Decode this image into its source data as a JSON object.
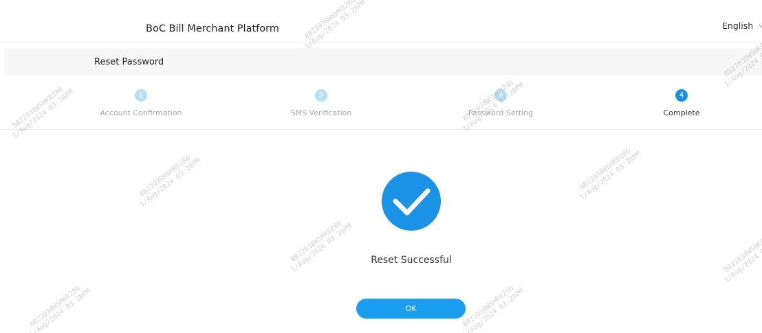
{
  "header": {
    "platform_name": "BoC Bill Merchant Platform",
    "language": "English"
  },
  "title_bar": {
    "title": "Reset Password"
  },
  "steps": [
    {
      "number": "1",
      "label": "Account Confirmation",
      "active": false
    },
    {
      "number": "2",
      "label": "SMS Verification",
      "active": false
    },
    {
      "number": "3",
      "label": "Password Setting",
      "active": false
    },
    {
      "number": "4",
      "label": "Complete",
      "active": true
    }
  ],
  "result": {
    "message": "Reset Successful",
    "ok_label": "OK"
  },
  "watermark": {
    "line1": "8822038WSHK0286",
    "line2": "1/Aug/2024 03:28PM"
  },
  "colors": {
    "accent": "#1890e8",
    "button": "#1a9ff0",
    "step_inactive": "#b6dff9"
  },
  "icons": {
    "success": "check-circle-icon",
    "language": "chevron-down-icon"
  }
}
